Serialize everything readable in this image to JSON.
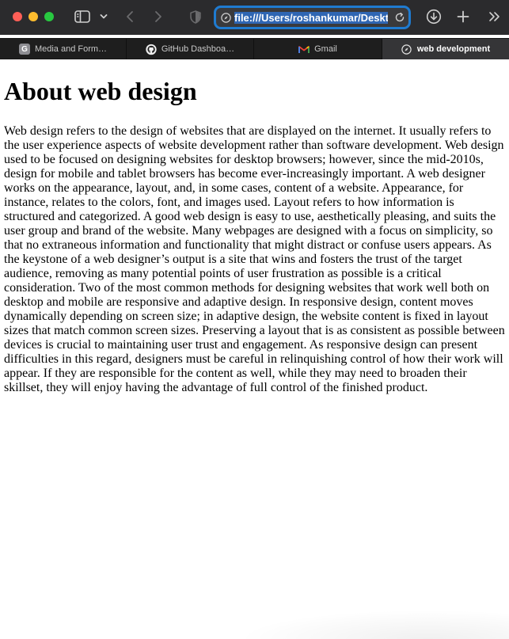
{
  "browser": {
    "url": "file:///Users/roshankumar/Deskto",
    "icons": [
      "sidebar-icon",
      "chevron-down-icon",
      "back-icon",
      "forward-icon",
      "shield-icon",
      "reload-icon",
      "download-icon",
      "new-tab-icon",
      "more-tabs-icon"
    ]
  },
  "tabs": [
    {
      "label": "Media and Form…",
      "favicon_letter": "G",
      "active": false
    },
    {
      "label": "GitHub Dashboa…",
      "active": false
    },
    {
      "label": "Gmail",
      "active": false
    },
    {
      "label": "web development",
      "active": true
    }
  ],
  "content": {
    "heading": "About web design",
    "paragraph": "Web design refers to the design of websites that are displayed on the internet. It usually refers to the user experience aspects of website development rather than software development. Web design used to be focused on designing websites for desktop browsers; however, since the mid-2010s, design for mobile and tablet browsers has become ever-increasingly important. A web designer works on the appearance, layout, and, in some cases, content of a website. Appearance, for instance, relates to the colors, font, and images used. Layout refers to how information is structured and categorized. A good web design is easy to use, aesthetically pleasing, and suits the user group and brand of the website. Many webpages are designed with a focus on simplicity, so that no extraneous information and functionality that might distract or confuse users appears. As the keystone of a web designer’s output is a site that wins and fosters the trust of the target audience, removing as many potential points of user frustration as possible is a critical consideration. Two of the most common methods for designing websites that work well both on desktop and mobile are responsive and adaptive design. In responsive design, content moves dynamically depending on screen size; in adaptive design, the website content is fixed in layout sizes that match common screen sizes. Preserving a layout that is as consistent as possible between devices is crucial to maintaining user trust and engagement. As responsive design can present difficulties in this regard, designers must be careful in relinquishing control of how their work will appear. If they are responsible for the content as well, while they may need to broaden their skillset, they will enjoy having the advantage of full control of the finished product."
  },
  "colors": {
    "toolbar": "#2b2b2d",
    "url_focus_ring": "#1f7bd0",
    "close": "#ff5f57",
    "minimize": "#febc2e",
    "maximize": "#28c840"
  }
}
